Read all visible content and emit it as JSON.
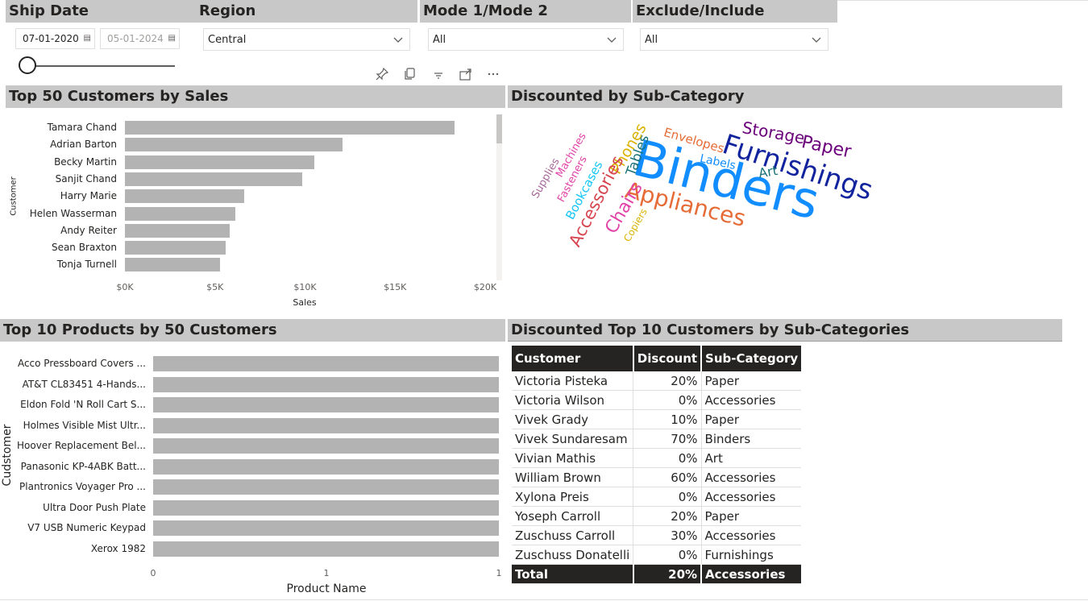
{
  "slicers": {
    "ship_date": {
      "title": "Ship Date",
      "start": "07-01-2020",
      "end": "05-01-2024"
    },
    "region": {
      "title": "Region",
      "value": "Central"
    },
    "mode": {
      "title": "Mode 1/Mode 2",
      "value": "All"
    },
    "exclude": {
      "title": "Exclude/Include",
      "value": "All"
    }
  },
  "visual_toolbar": {
    "icons": [
      "pin-icon",
      "copy-icon",
      "filter-icon",
      "focus-mode-icon",
      "more-options-icon"
    ]
  },
  "customers_chart": {
    "title": "Top 50 Customers by Sales",
    "chart_data": {
      "type": "bar",
      "orientation": "horizontal",
      "title": "Top 50 Customers by Sales",
      "xlabel": "Sales",
      "ylabel": "Customer",
      "categories": [
        "Tamara Chand",
        "Adrian Barton",
        "Becky Martin",
        "Sanjit Chand",
        "Harry Marie",
        "Helen Wasserman",
        "Andy Reiter",
        "Sean Braxton",
        "Tonja Turnell"
      ],
      "values": [
        18300,
        12100,
        10500,
        9850,
        6600,
        6150,
        5800,
        5600,
        5300
      ],
      "xlim": [
        0,
        20000
      ],
      "xticks": [
        "$0K",
        "$5K",
        "$10K",
        "$15K",
        "$20K"
      ],
      "color": "#b3b3b3"
    }
  },
  "wordcloud": {
    "title": "Discounted by Sub-Category",
    "words": [
      {
        "text": "Binders",
        "color": "#118dff"
      },
      {
        "text": "Furnishings",
        "color": "#12239e"
      },
      {
        "text": "Appliances",
        "color": "#e66c37"
      },
      {
        "text": "Storage",
        "color": "#6b007b"
      },
      {
        "text": "Paper",
        "color": "#6b007b"
      },
      {
        "text": "Art",
        "color": "#197278"
      },
      {
        "text": "Labels",
        "color": "#118dff"
      },
      {
        "text": "Envelopes",
        "color": "#e66c37"
      },
      {
        "text": "Tables",
        "color": "#197278"
      },
      {
        "text": "Phones",
        "color": "#d9b300"
      },
      {
        "text": "Chairs",
        "color": "#e044a7"
      },
      {
        "text": "Copiers",
        "color": "#d9b300"
      },
      {
        "text": "Accessories",
        "color": "#d64550"
      },
      {
        "text": "Bookcases",
        "color": "#15c6f4"
      },
      {
        "text": "Fasteners",
        "color": "#e044a7"
      },
      {
        "text": "Machines",
        "color": "#e044a7"
      },
      {
        "text": "Supplies",
        "color": "#a66999"
      }
    ]
  },
  "products_chart": {
    "title": "Top 10 Products by 50 Customers",
    "chart_data": {
      "type": "bar",
      "orientation": "horizontal",
      "title": "Top 10 Products by 50 Customers",
      "xlabel": "Product Name",
      "ylabel": "Cudstomer",
      "categories": [
        "Acco Pressboard Covers ...",
        "AT&T CL83451 4-Hands...",
        "Eldon Fold 'N Roll Cart S...",
        "Holmes Visible Mist Ultr...",
        "Hoover Replacement Bel...",
        "Panasonic KP-4ABK Batt...",
        "Plantronics Voyager Pro ...",
        "Ultra Door Push Plate",
        "V7 USB Numeric Keypad",
        "Xerox 1982"
      ],
      "values": [
        1,
        1,
        1,
        1,
        1,
        1,
        1,
        1,
        1,
        1
      ],
      "xlim": [
        0,
        1
      ],
      "xticks": [
        "0",
        "1",
        "1"
      ],
      "color": "#b3b3b3"
    }
  },
  "table": {
    "title": "Discounted Top 10 Customers by Sub-Categories",
    "columns": [
      "Customer",
      "Discount",
      "Sub-Category"
    ],
    "rows": [
      [
        "Victoria Pisteka",
        "20%",
        "Paper"
      ],
      [
        "Victoria Wilson",
        "0%",
        "Accessories"
      ],
      [
        "Vivek Grady",
        "10%",
        "Paper"
      ],
      [
        "Vivek Sundaresam",
        "70%",
        "Binders"
      ],
      [
        "Vivian Mathis",
        "0%",
        "Art"
      ],
      [
        "William Brown",
        "60%",
        "Accessories"
      ],
      [
        "Xylona Preis",
        "0%",
        "Accessories"
      ],
      [
        "Yoseph Carroll",
        "20%",
        "Paper"
      ],
      [
        "Zuschuss Carroll",
        "30%",
        "Accessories"
      ],
      [
        "Zuschuss Donatelli",
        "0%",
        "Furnishings"
      ]
    ],
    "total": [
      "Total",
      "20%",
      "Accessories"
    ]
  }
}
